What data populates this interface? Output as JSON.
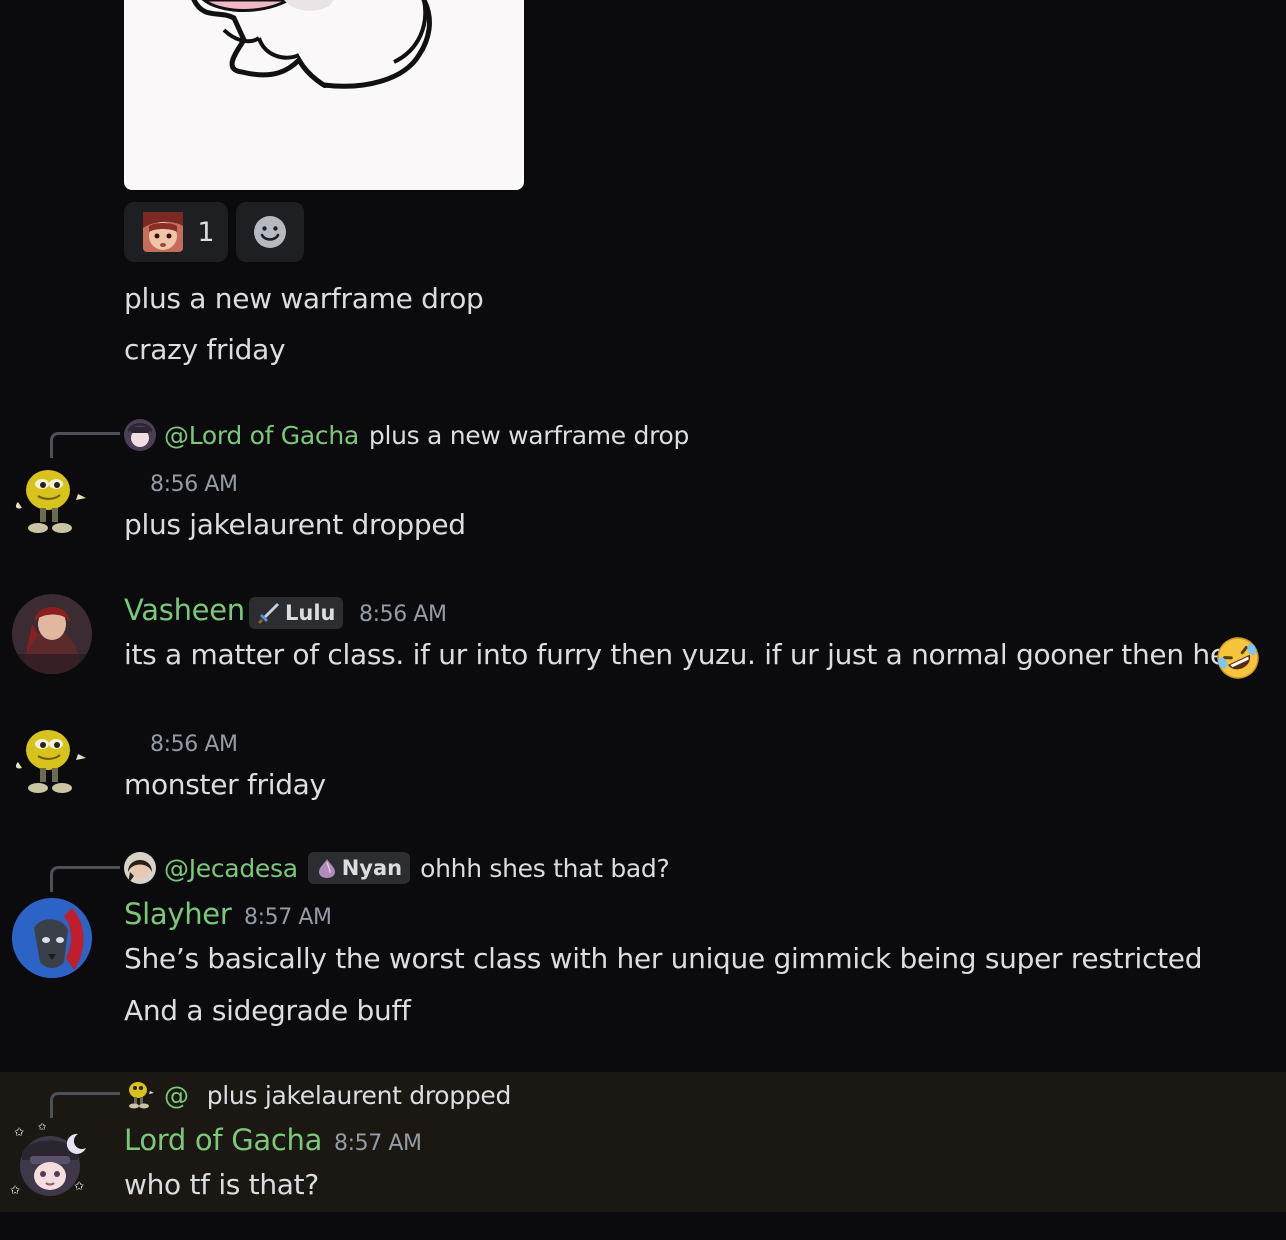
{
  "reactions": {
    "main": {
      "icon": "anime-face-emoji",
      "count": "1"
    },
    "add": {
      "icon": "add-reaction-smiley-icon"
    }
  },
  "messages": [
    {
      "id": "m1",
      "lines": [
        "plus a new warframe drop",
        "crazy friday"
      ]
    },
    {
      "id": "m2",
      "reply": {
        "mention": "@Lord of Gacha",
        "text": "plus a new warframe drop"
      },
      "time": "8:56 AM",
      "lines": [
        "plus jakelaurent dropped"
      ]
    },
    {
      "id": "m3",
      "author": "Vasheen",
      "role": {
        "icon": "sword-icon",
        "label": "Lulu"
      },
      "time": "8:56 AM",
      "lines": [
        "its a matter of class. if ur into furry then yuzu. if ur just a normal gooner then her"
      ],
      "emoji": "rolling-on-floor-laughing-emoji"
    },
    {
      "id": "m4",
      "time": "8:56 AM",
      "lines": [
        "monster friday"
      ]
    },
    {
      "id": "m5",
      "reply": {
        "mention": "@Jecadesa",
        "role": {
          "icon": "onion-icon",
          "label": "Nyan"
        },
        "text": "ohhh shes that bad?"
      },
      "author": "Slayher",
      "time": "8:57 AM",
      "lines": [
        "She’s basically the worst class with her unique gimmick being super restricted",
        "And a sidegrade buff"
      ]
    },
    {
      "id": "m6",
      "reply": {
        "mention": "@",
        "text": "plus jakelaurent dropped"
      },
      "author": "Lord of Gacha",
      "time": "8:57 AM",
      "lines": [
        "who tf is that?"
      ]
    }
  ],
  "colors": {
    "background": "#0b0b0d",
    "username": "#7bc87b",
    "text": "#dbdee1",
    "muted": "#949ba4",
    "highlight": "#1b1713"
  }
}
